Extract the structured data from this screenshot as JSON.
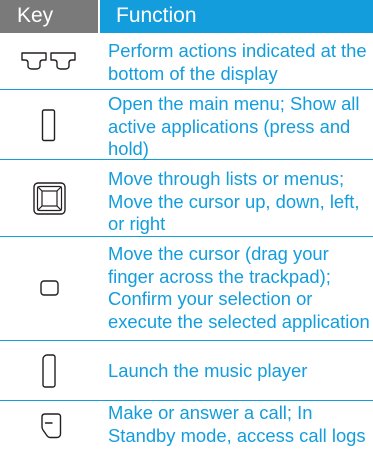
{
  "header": {
    "key_label": "Key",
    "function_label": "Function"
  },
  "rows": [
    {
      "icon": "softkeys-icon",
      "function": "Perform actions indicated at the bottom of the display"
    },
    {
      "icon": "menu-key-icon",
      "function": "Open the main menu; Show all active applications (press and hold)"
    },
    {
      "icon": "navigation-key-icon",
      "function": "Move through lists or menus; Move the cursor up, down, left, or right"
    },
    {
      "icon": "trackpad-icon",
      "function": "Move the cursor (drag your finger across the trackpad); Confirm your selection or execute the selected application"
    },
    {
      "icon": "music-key-icon",
      "function": "Launch the music player"
    },
    {
      "icon": "dial-key-icon",
      "function": "Make or answer a call; In Standby mode, access call logs"
    }
  ],
  "colors": {
    "accent": "#139ddd",
    "key_header": "#7a7a7a",
    "icon_stroke": "#231f20"
  }
}
